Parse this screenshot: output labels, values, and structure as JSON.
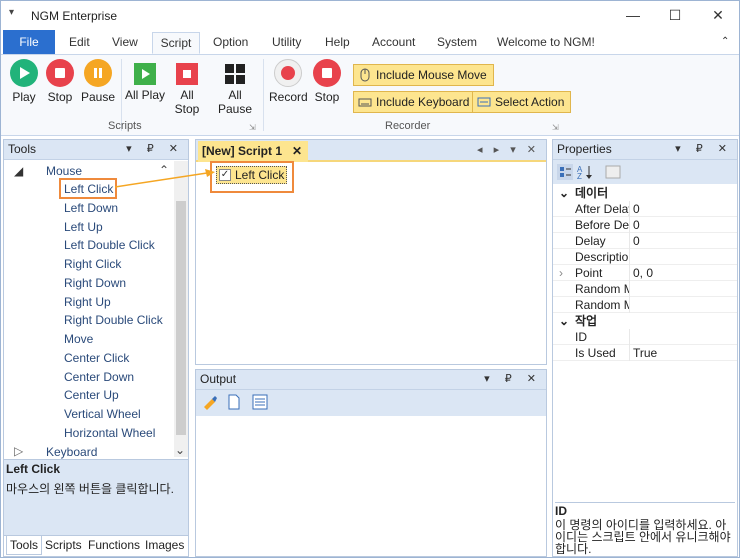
{
  "window": {
    "title": "NGM Enterprise",
    "quick_access": "▾",
    "minimize": "—",
    "maximize": "☐",
    "close": "✕"
  },
  "ribbon_tabs": {
    "file": "File",
    "edit": "Edit",
    "view": "View",
    "script": "Script",
    "option": "Option",
    "utility": "Utility",
    "help": "Help",
    "account": "Account",
    "system": "System",
    "welcome": "Welcome to NGM!",
    "collapse": "⌃"
  },
  "scripts_group": {
    "label": "Scripts",
    "play": "Play",
    "stop": "Stop",
    "pause": "Pause",
    "all_play": "All Play",
    "all_stop": "All Stop",
    "all_pause": "All Pause"
  },
  "recorder_group": {
    "label": "Recorder",
    "record": "Record",
    "stop": "Stop",
    "include_mouse_move": "Include Mouse Move",
    "include_keyboard": "Include Keyboard",
    "select_action": "Select Action"
  },
  "tools_panel": {
    "title": "Tools",
    "controls": "▾ ₽ ✕",
    "root_mouse": "Mouse",
    "items": [
      "Left Click",
      "Left Down",
      "Left Up",
      "Left Double Click",
      "Right Click",
      "Right Down",
      "Right Up",
      "Right Double Click",
      "Move",
      "Center Click",
      "Center Down",
      "Center Up",
      "Vertical Wheel",
      "Horizontal Wheel"
    ],
    "root_keyboard": "Keyboard",
    "desc_title": "Left Click",
    "desc_text": "마우스의 왼쪽 버튼을 클릭합니다.",
    "bottom_tabs": [
      "Tools",
      "Scripts",
      "Functions",
      "Images"
    ]
  },
  "script_doc": {
    "tab_label": "[New] Script 1",
    "tab_close": "✕",
    "nav": "◂ ▸ ▾ ✕",
    "action_label": "Left Click",
    "action_checked": true
  },
  "output_panel": {
    "title": "Output",
    "controls": "▾ ₽ ✕"
  },
  "properties_panel": {
    "title": "Properties",
    "controls": "▾ ₽ ✕",
    "cat_data": "데이터",
    "rows_data": [
      {
        "name": "After Delay",
        "value": "0"
      },
      {
        "name": "Before Delay",
        "value": "0"
      },
      {
        "name": "Delay",
        "value": "0"
      },
      {
        "name": "Description",
        "value": ""
      },
      {
        "name": "Point",
        "value": "0, 0"
      },
      {
        "name": "Random Move",
        "value": ""
      },
      {
        "name": "Random Move",
        "value": ""
      }
    ],
    "cat_job": "작업",
    "rows_job": [
      {
        "name": "ID",
        "value": ""
      },
      {
        "name": "Is Used",
        "value": "True"
      }
    ],
    "desc_title": "ID",
    "desc_text": "이 명령의 아이디를 입력하세요. 아이디는 스크립트 안에서 유니크해야 합니다."
  },
  "colors": {
    "accent_blue": "#2b6fcf",
    "highlight_orange": "#ef8a3c",
    "button_yellow": "#fde58f",
    "play_green": "#21b37a",
    "stop_red": "#e8424c",
    "pause_orange": "#f5a623"
  }
}
